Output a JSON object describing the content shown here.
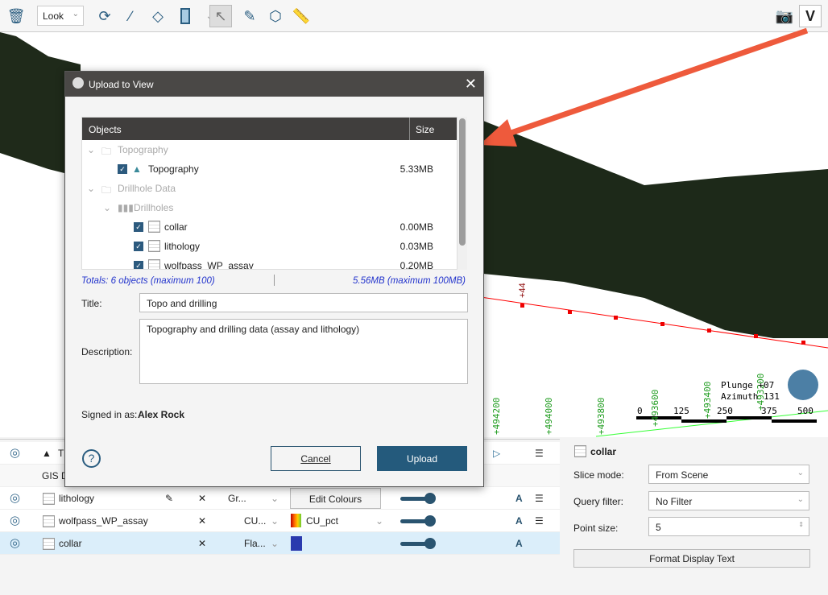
{
  "toolbar": {
    "view_mode": "Look",
    "icons": [
      "delete-view-icon",
      "rotate-icon",
      "draw-line-icon",
      "polygon-icon",
      "slice-icon",
      "select-arrow-icon",
      "pen-icon",
      "polyline-edit-icon",
      "ruler-icon",
      "camera-icon",
      "upload-view-icon"
    ]
  },
  "scene": {
    "plunge": "Plunge +07",
    "azimuth": "Azimuth 131",
    "scale_labels": [
      "0",
      "125",
      "250",
      "375",
      "500"
    ],
    "green_labels": [
      "+494200",
      "+494000",
      "+493800",
      "+493600",
      "+493400",
      "+493200"
    ],
    "red_labels": [
      "+44"
    ]
  },
  "dialog": {
    "title": "Upload to View",
    "columns": {
      "objects": "Objects",
      "size": "Size"
    },
    "rows": [
      {
        "label": "Topography",
        "size": "",
        "type": "folder",
        "checked": null
      },
      {
        "label": "Topography",
        "size": "5.33MB",
        "type": "surface",
        "checked": true
      },
      {
        "label": "Drillhole Data",
        "size": "",
        "type": "folder",
        "checked": null
      },
      {
        "label": "Drillholes",
        "size": "",
        "type": "drillholes",
        "checked": null
      },
      {
        "label": "collar",
        "size": "0.00MB",
        "type": "table",
        "checked": true
      },
      {
        "label": "lithology",
        "size": "0.03MB",
        "type": "table",
        "checked": true
      },
      {
        "label": "wolfpass_WP_assay",
        "size": "0.20MB",
        "type": "table",
        "checked": true
      }
    ],
    "totals_objects": "Totals: 6 objects (maximum 100)",
    "totals_size": "5.56MB (maximum 100MB)",
    "title_label": "Title:",
    "title_value": "Topo and drilling",
    "description_label": "Description:",
    "description_value": "Topography and drilling data (assay and lithology)",
    "signed_in_prefix": "Signed in as:",
    "signed_in_user": "Alex Rock",
    "cancel": "Cancel",
    "upload": "Upload"
  },
  "layers": [
    {
      "name": "T",
      "extra": ""
    },
    {
      "name": "GIS D",
      "extra": ""
    },
    {
      "name": "lithology",
      "style": "Gr...",
      "colour": "Edit Colours"
    },
    {
      "name": "wolfpass_WP_assay",
      "style": "CU...",
      "colour": "CU_pct"
    },
    {
      "name": "collar",
      "style": "Fla...",
      "colour": "",
      "swatch": "#2a3aae"
    }
  ],
  "properties": {
    "object": "collar",
    "slice_mode_label": "Slice mode:",
    "slice_mode": "From Scene",
    "query_filter_label": "Query filter:",
    "query_filter": "No Filter",
    "point_size_label": "Point size:",
    "point_size": "5",
    "format_button": "Format Display Text"
  },
  "colors": {
    "accent": "#245a7c",
    "arrow": "#ee5a3c",
    "highlight": "#dbeefa"
  }
}
